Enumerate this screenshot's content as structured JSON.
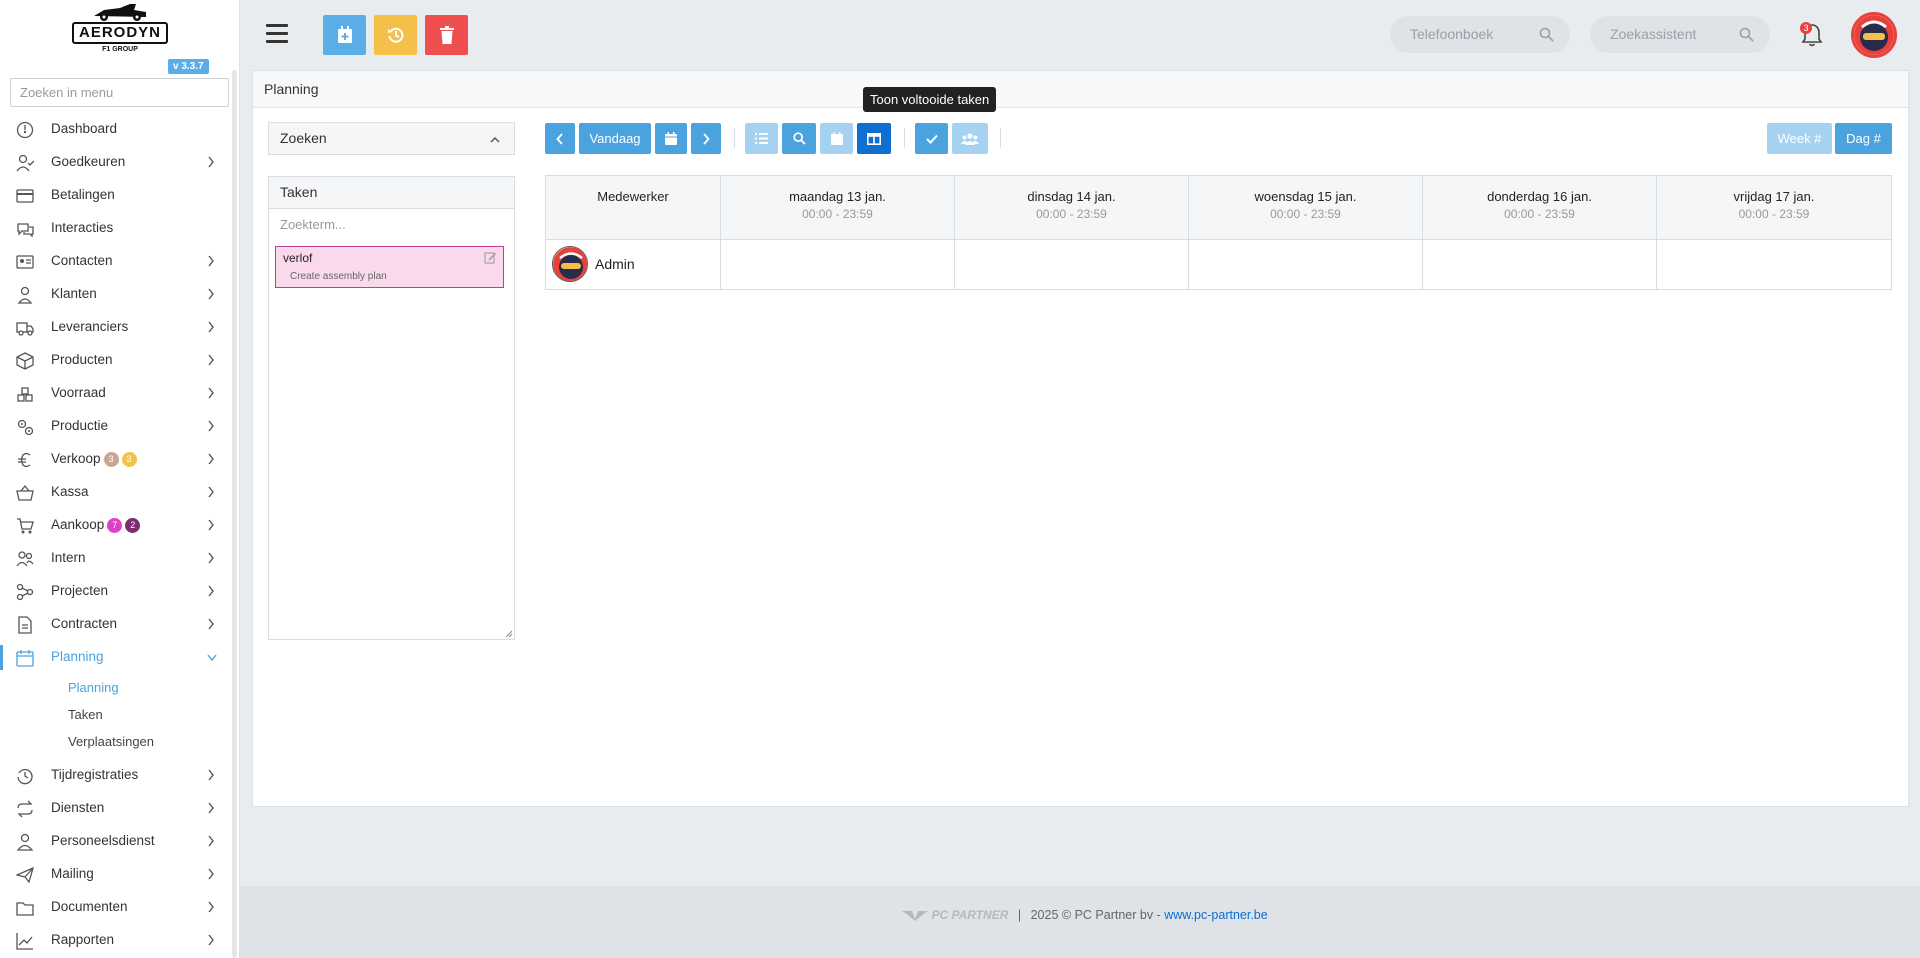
{
  "sidebar": {
    "brand": "AERODYN",
    "brand_sub": "F1 GROUP",
    "version": "v 3.3.7",
    "search_placeholder": "Zoeken in menu",
    "items": [
      {
        "label": "Dashboard",
        "icon": "speedometer-icon",
        "chevron": false
      },
      {
        "label": "Goedkeuren",
        "icon": "user-check-icon",
        "chevron": true
      },
      {
        "label": "Betalingen",
        "icon": "credit-card-icon",
        "chevron": false
      },
      {
        "label": "Interacties",
        "icon": "chat-bubbles-icon",
        "chevron": false
      },
      {
        "label": "Contacten",
        "icon": "contact-card-icon",
        "chevron": true
      },
      {
        "label": "Klanten",
        "icon": "person-icon",
        "chevron": true
      },
      {
        "label": "Leveranciers",
        "icon": "truck-icon",
        "chevron": true
      },
      {
        "label": "Producten",
        "icon": "box-icon",
        "chevron": true
      },
      {
        "label": "Voorraad",
        "icon": "boxes-icon",
        "chevron": true
      },
      {
        "label": "Productie",
        "icon": "gears-icon",
        "chevron": true
      },
      {
        "label": "Verkoop",
        "icon": "euro-icon",
        "chevron": true,
        "badges": [
          {
            "value": "3",
            "color": "#c9a68f"
          },
          {
            "value": "3",
            "color": "#f2c14e"
          }
        ]
      },
      {
        "label": "Kassa",
        "icon": "basket-icon",
        "chevron": true
      },
      {
        "label": "Aankoop",
        "icon": "cart-icon",
        "chevron": true,
        "badges": [
          {
            "value": "7",
            "color": "#e040c9"
          },
          {
            "value": "2",
            "color": "#7b2d6f"
          }
        ]
      },
      {
        "label": "Intern",
        "icon": "people-icon",
        "chevron": true
      },
      {
        "label": "Projecten",
        "icon": "diagram-icon",
        "chevron": true
      },
      {
        "label": "Contracten",
        "icon": "document-icon",
        "chevron": true
      },
      {
        "label": "Planning",
        "icon": "calendar-icon",
        "chevron": true,
        "active": true
      }
    ],
    "planning_sub": [
      {
        "label": "Planning",
        "active": true
      },
      {
        "label": "Taken"
      },
      {
        "label": "Verplaatsingen"
      }
    ],
    "items_after": [
      {
        "label": "Tijdregistraties",
        "icon": "clock-icon",
        "chevron": true
      },
      {
        "label": "Diensten",
        "icon": "repeat-icon",
        "chevron": true
      },
      {
        "label": "Personeelsdienst",
        "icon": "staff-icon",
        "chevron": true
      },
      {
        "label": "Mailing",
        "icon": "paper-plane-icon",
        "chevron": true
      },
      {
        "label": "Documenten",
        "icon": "folder-icon",
        "chevron": true
      },
      {
        "label": "Rapporten",
        "icon": "chart-line-icon",
        "chevron": true
      }
    ]
  },
  "topbar": {
    "search_phonebook": "Telefoonboek",
    "search_assistant": "Zoekassistent",
    "notification_count": "3",
    "colors": {
      "blue": "#5aaee8",
      "yellow": "#f5c04a",
      "red": "#ef4f4f"
    }
  },
  "panel": {
    "title": "Planning",
    "tooltip": "Toon voltooide taken",
    "zoeken": "Zoeken",
    "taken_title": "Taken",
    "taken_placeholder": "Zoekterm...",
    "task": {
      "title": "verlof",
      "subtitle": "Create assembly plan"
    },
    "toolbar": {
      "today": "Vandaag",
      "week": "Week #",
      "day": "Dag #"
    },
    "calendar": {
      "employee_header": "Medewerker",
      "days": [
        {
          "day": "maandag 13 jan.",
          "hours": "00:00 - 23:59"
        },
        {
          "day": "dinsdag 14 jan.",
          "hours": "00:00 - 23:59"
        },
        {
          "day": "woensdag 15 jan.",
          "hours": "00:00 - 23:59"
        },
        {
          "day": "donderdag 16 jan.",
          "hours": "00:00 - 23:59"
        },
        {
          "day": "vrijdag 17 jan.",
          "hours": "00:00 - 23:59"
        }
      ],
      "employees": [
        {
          "name": "Admin"
        }
      ]
    }
  },
  "footer": {
    "logo_text": "PC PARTNER",
    "copyright": "2025 © PC Partner bv - ",
    "link": "www.pc-partner.be"
  }
}
